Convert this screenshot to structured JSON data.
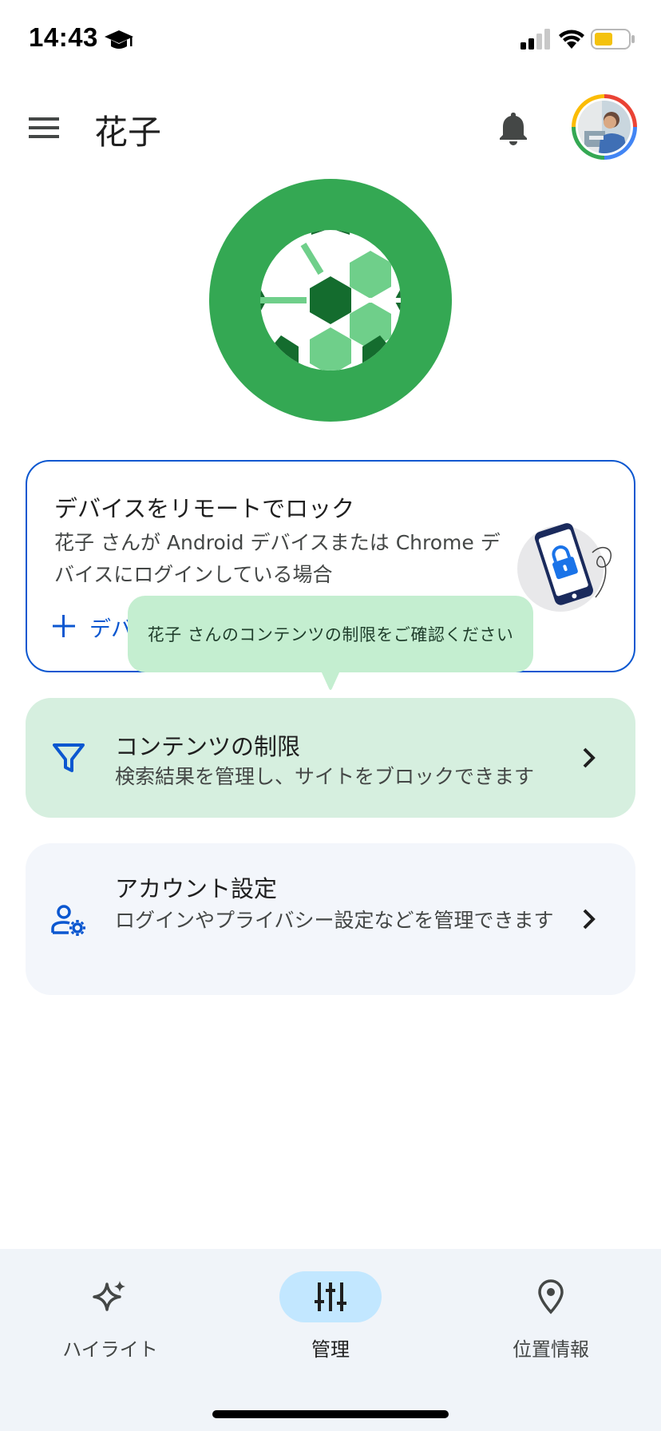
{
  "status_bar": {
    "time": "14:43",
    "icons": [
      "graduation-cap-icon",
      "cellular-signal-icon",
      "wifi-icon",
      "battery-icon"
    ],
    "battery_color": "#f4c20d"
  },
  "app_bar": {
    "menu_icon": "hamburger-menu-icon",
    "title": "花子",
    "notification_icon": "bell-icon",
    "avatar_ring_colors": [
      "#ea4335",
      "#4285f4",
      "#34a853",
      "#fbbc05"
    ]
  },
  "hero": {
    "icon": "soccer-ball-icon",
    "color": "#34a853"
  },
  "lock_card": {
    "title": "デバイスをリモートでロック",
    "description": "花子 さんが Android デバイスまたは Chrome デバイスにログインしている場合",
    "action_label": "デバイスを追加",
    "action_icon": "plus-icon",
    "illustration": "locked-phone-illustration",
    "border_color": "#0b57d0"
  },
  "tooltip": {
    "text": "花子 さんのコンテンツの制限をご確認ください",
    "background": "#c4eed0"
  },
  "settings_rows": [
    {
      "icon": "filter-icon",
      "title": "コンテンツの制限",
      "subtitle": "検索結果を管理し、サイトをブロックできます",
      "background": "#d6efdf"
    },
    {
      "icon": "manage-account-icon",
      "title": "アカウント設定",
      "subtitle": "ログインやプライバシー設定などを管理できます",
      "background": "#f3f6fb"
    }
  ],
  "bottom_nav": {
    "items": [
      {
        "label": "ハイライト",
        "icon": "sparkle-icon",
        "active": false
      },
      {
        "label": "管理",
        "icon": "tune-sliders-icon",
        "active": true
      },
      {
        "label": "位置情報",
        "icon": "location-pin-icon",
        "active": false
      }
    ],
    "active_color": "#c2e7ff"
  },
  "theme": {
    "accent_blue": "#0b57d0",
    "text_primary": "#1f1f1f",
    "text_secondary": "#444746"
  }
}
